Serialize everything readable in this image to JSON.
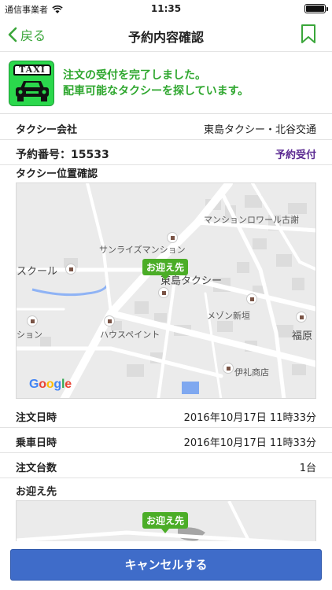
{
  "status_bar": {
    "carrier": "通信事業者",
    "time": "11:35",
    "battery_level": 1.0
  },
  "nav": {
    "back_label": "戻る",
    "title": "予約内容確認"
  },
  "banner": {
    "logo_text": "TAXI",
    "message_line1": "注文の受付を完了しました。",
    "message_line2": "配車可能なタクシーを探しています。"
  },
  "details": {
    "company_label": "タクシー会社",
    "company_value": "東島タクシー・北谷交通",
    "reservation_label": "予約番号：",
    "reservation_number": "15533",
    "reservation_status": "予約受付",
    "location_label": "タクシー位置確認",
    "order_time_label": "注文日時",
    "order_time_value": "2016年10月17日 11時33分",
    "ride_time_label": "乗車日時",
    "ride_time_value": "2016年10月17日 11時33分",
    "count_label": "注文台数",
    "count_value": "1台",
    "pickup_label": "お迎え先"
  },
  "map": {
    "pickup_badge": "お迎え先",
    "labels": {
      "mansion_roir": "マンションロワール古謝",
      "sunrise": "サンライズマンション",
      "school": "スクール",
      "higashijima": "東島タクシー",
      "meson": "メゾン新垣",
      "fukuhara": "福原",
      "house_paint": "ハウスペイント",
      "mansion_left": "ション",
      "irei": "伊礼商店"
    },
    "google_letters": [
      "G",
      "o",
      "o",
      "g",
      "l",
      "e"
    ],
    "google_colors": [
      "#4285F4",
      "#EA4335",
      "#FBBC05",
      "#4285F4",
      "#34A853",
      "#EA4335"
    ]
  },
  "map2": {
    "pickup_badge": "お迎え先"
  },
  "cancel": {
    "label": "キャンセルする"
  },
  "colors": {
    "accent_green": "#3aa63a",
    "cancel_blue": "#3f6cc9",
    "status_purple": "#5b2a92"
  }
}
